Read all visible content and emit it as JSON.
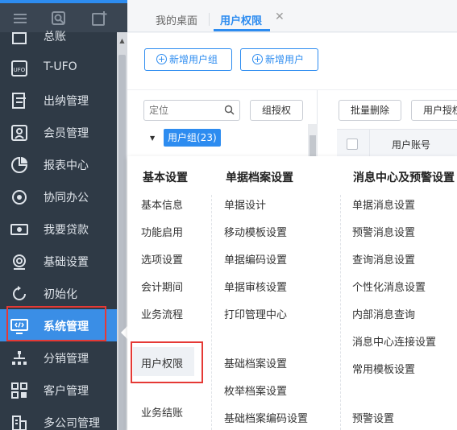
{
  "sidebar": {
    "items": [
      {
        "label": "总账",
        "icon": "ledger-icon"
      },
      {
        "label": "T-UFO",
        "icon": "ufo-icon"
      },
      {
        "label": "出纳管理",
        "icon": "cashier-icon"
      },
      {
        "label": "会员管理",
        "icon": "member-icon"
      },
      {
        "label": "报表中心",
        "icon": "report-icon"
      },
      {
        "label": "协同办公",
        "icon": "collaboration-icon"
      },
      {
        "label": "我要贷款",
        "icon": "loan-icon"
      },
      {
        "label": "基础设置",
        "icon": "settings-icon"
      },
      {
        "label": "初始化",
        "icon": "init-icon"
      },
      {
        "label": "系统管理",
        "icon": "system-icon",
        "active": true
      },
      {
        "label": "分销管理",
        "icon": "distribution-icon"
      },
      {
        "label": "客户管理",
        "icon": "customer-icon"
      },
      {
        "label": "多公司管理",
        "icon": "multi-company-icon"
      }
    ]
  },
  "tabs": [
    {
      "label": "我的桌面"
    },
    {
      "label": "用户权限",
      "active": true
    }
  ],
  "toolbar": {
    "add_group_label": "新增用户组",
    "add_user_label": "新增用户"
  },
  "content": {
    "search": {
      "placeholder": "定位"
    },
    "group_auth_label": "组授权",
    "batch_delete_label": "批量删除",
    "user_auth_label": "用户授权",
    "tree_node_label": "用户组(23)",
    "column_user_account": "用户账号"
  },
  "panel": {
    "columns": [
      {
        "title": "基本设置",
        "items": [
          "基本信息",
          "功能启用",
          "选项设置",
          "会计期间",
          "业务流程",
          "用户权限",
          "业务结账"
        ]
      },
      {
        "title": "单据档案设置",
        "items": [
          "单据设计",
          "移动模板设置",
          "单据编码设置",
          "单据审核设置",
          "打印管理中心",
          "基础档案设置",
          "枚举档案设置",
          "基础档案编码设置"
        ]
      },
      {
        "title": "消息中心及预警设置",
        "items": [
          "单据消息设置",
          "预警消息设置",
          "查询消息设置",
          "个性化消息设置",
          "内部消息查询",
          "消息中心连接设置",
          "常用模板设置",
          "预警设置"
        ]
      }
    ]
  },
  "colors": {
    "sidebar_bg": "#2f3a46",
    "active_bg": "#3a8ee6",
    "accent": "#2d8cf0",
    "highlight_border": "#e53935"
  }
}
